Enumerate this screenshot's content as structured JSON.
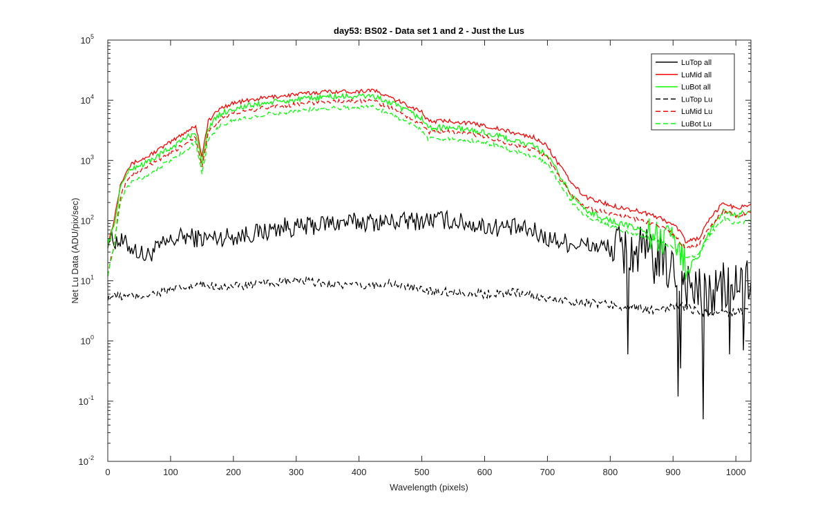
{
  "chart_data": {
    "type": "line",
    "title": "day53: BS02 - Data set 1 and 2 - Just the Lus",
    "xlabel": "Wavelength (pixels)",
    "ylabel": "Net Lu Data (ADU/pix/sec)",
    "xlim": [
      0,
      1024
    ],
    "ylim": [
      0.01,
      100000
    ],
    "yscale": "log",
    "x_ticks": [
      0,
      100,
      200,
      300,
      400,
      500,
      600,
      700,
      800,
      900,
      1000
    ],
    "x_tick_labels": [
      "0",
      "100",
      "200",
      "300",
      "400",
      "500",
      "600",
      "700",
      "800",
      "900",
      "1000"
    ],
    "y_ticks": [
      0.01,
      0.1,
      1,
      10,
      100,
      1000,
      10000,
      100000
    ],
    "y_tick_labels": [
      {
        "base": "10",
        "exp": "-2"
      },
      {
        "base": "10",
        "exp": "-1"
      },
      {
        "base": "10",
        "exp": "0"
      },
      {
        "base": "10",
        "exp": "1"
      },
      {
        "base": "10",
        "exp": "2"
      },
      {
        "base": "10",
        "exp": "3"
      },
      {
        "base": "10",
        "exp": "4"
      },
      {
        "base": "10",
        "exp": "5"
      }
    ],
    "grid": false,
    "legend_position": "top-right",
    "series": [
      {
        "name": "LuTop  all",
        "color": "#000000",
        "dash": "solid",
        "x": [
          0,
          20,
          40,
          60,
          80,
          100,
          120,
          150,
          200,
          250,
          280,
          300,
          350,
          400,
          450,
          500,
          530,
          560,
          600,
          650,
          680,
          700,
          750,
          800,
          830,
          850,
          880,
          900,
          920,
          950,
          980,
          1000,
          1024
        ],
        "y": [
          50,
          45,
          35,
          25,
          35,
          45,
          55,
          50,
          55,
          65,
          80,
          75,
          90,
          95,
          95,
          100,
          105,
          95,
          80,
          75,
          65,
          50,
          40,
          35,
          30,
          30,
          20,
          15,
          10,
          5,
          8,
          8,
          10
        ],
        "spikes": [
          {
            "x": 828,
            "y": 0.6
          },
          {
            "x": 908,
            "y": 0.12
          },
          {
            "x": 912,
            "y": 0.35
          },
          {
            "x": 948,
            "y": 0.05
          },
          {
            "x": 990,
            "y": 0.6
          },
          {
            "x": 1012,
            "y": 0.7
          }
        ]
      },
      {
        "name": "LuMid  all",
        "color": "#ff0000",
        "dash": "solid",
        "x": [
          0,
          10,
          20,
          30,
          40,
          60,
          80,
          100,
          120,
          140,
          150,
          160,
          180,
          200,
          250,
          300,
          350,
          400,
          420,
          450,
          500,
          510,
          550,
          600,
          650,
          680,
          700,
          720,
          740,
          760,
          800,
          850,
          880,
          900,
          910,
          920,
          940,
          960,
          980,
          1000,
          1024
        ],
        "y": [
          40,
          100,
          400,
          700,
          900,
          1100,
          1500,
          2000,
          2800,
          3800,
          1200,
          4500,
          7500,
          9000,
          11000,
          12500,
          14000,
          14000,
          15000,
          11000,
          6500,
          4500,
          4500,
          3800,
          2800,
          2400,
          1700,
          800,
          400,
          250,
          180,
          140,
          110,
          85,
          70,
          45,
          50,
          110,
          200,
          160,
          190
        ]
      },
      {
        "name": "LuBot  all",
        "color": "#00ff00",
        "dash": "solid",
        "x": [
          0,
          10,
          20,
          30,
          40,
          60,
          80,
          100,
          120,
          140,
          150,
          160,
          180,
          200,
          250,
          300,
          350,
          400,
          420,
          450,
          500,
          510,
          550,
          600,
          650,
          680,
          700,
          720,
          740,
          760,
          800,
          850,
          880,
          900,
          910,
          920,
          940,
          960,
          980,
          1000,
          1024
        ],
        "y": [
          40,
          80,
          350,
          600,
          750,
          900,
          1200,
          1600,
          2200,
          3000,
          900,
          3600,
          6000,
          7200,
          9000,
          10000,
          11500,
          11500,
          12000,
          9000,
          5000,
          3500,
          3500,
          2900,
          2100,
          1700,
          1200,
          550,
          250,
          150,
          100,
          70,
          50,
          40,
          28,
          20,
          25,
          70,
          140,
          120,
          150
        ]
      },
      {
        "name": "LuTop  Lu",
        "color": "#000000",
        "dash": "dashed",
        "x": [
          0,
          50,
          100,
          150,
          200,
          250,
          300,
          350,
          400,
          450,
          500,
          550,
          600,
          650,
          700,
          750,
          800,
          850,
          880,
          900,
          950,
          1000,
          1024
        ],
        "y": [
          5.5,
          5.5,
          7,
          8.5,
          8,
          9,
          10,
          9,
          8,
          9,
          7,
          6.5,
          6,
          6.5,
          5,
          4.5,
          4,
          3.5,
          3,
          4,
          3,
          3,
          3.5
        ]
      },
      {
        "name": "LuMid  Lu",
        "color": "#ff0000",
        "dash": "dashed",
        "x": [
          0,
          10,
          20,
          30,
          40,
          60,
          80,
          100,
          120,
          140,
          150,
          160,
          180,
          200,
          250,
          300,
          350,
          400,
          420,
          450,
          500,
          510,
          550,
          600,
          650,
          680,
          700,
          720,
          740,
          760,
          800,
          850,
          880,
          900,
          910,
          920,
          940,
          960,
          980,
          1000,
          1024
        ],
        "y": [
          13,
          40,
          250,
          450,
          600,
          750,
          1000,
          1300,
          1800,
          2500,
          800,
          3000,
          5000,
          6000,
          7500,
          8500,
          9500,
          9500,
          10000,
          7500,
          4000,
          3000,
          3000,
          2500,
          1800,
          1500,
          1100,
          500,
          250,
          170,
          130,
          100,
          80,
          60,
          45,
          35,
          38,
          80,
          140,
          120,
          140
        ]
      },
      {
        "name": "LuBot  Lu",
        "color": "#00ff00",
        "dash": "dashed",
        "x": [
          0,
          10,
          20,
          30,
          40,
          60,
          80,
          100,
          120,
          140,
          150,
          160,
          180,
          200,
          250,
          300,
          350,
          400,
          420,
          450,
          500,
          510,
          550,
          600,
          650,
          680,
          700,
          720,
          740,
          760,
          800,
          850,
          880,
          900,
          910,
          920,
          940,
          960,
          980,
          1000,
          1024
        ],
        "y": [
          13,
          35,
          200,
          350,
          450,
          550,
          750,
          1000,
          1400,
          2000,
          600,
          2300,
          3800,
          4600,
          5800,
          6600,
          7500,
          7500,
          8000,
          6000,
          3200,
          2300,
          2300,
          2000,
          1400,
          1150,
          850,
          400,
          200,
          120,
          80,
          55,
          45,
          35,
          28,
          24,
          28,
          60,
          110,
          90,
          100
        ]
      }
    ]
  }
}
